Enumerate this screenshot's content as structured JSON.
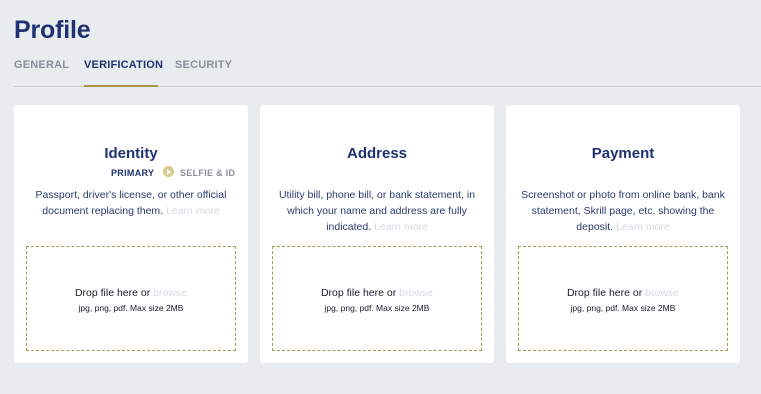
{
  "page": {
    "title": "Profile"
  },
  "tabs": [
    {
      "label": "GENERAL",
      "active": false
    },
    {
      "label": "VERIFICATION",
      "active": true
    },
    {
      "label": "SECURITY",
      "active": false
    }
  ],
  "cards": [
    {
      "title": "Identity",
      "steps": {
        "primary": "PRIMARY",
        "secondary": "SELFIE & ID"
      },
      "description": "Passport, driver's license, or other official document replacing them.",
      "learn_more": "Learn more",
      "drop_text": "Drop file here or",
      "browse": "browse",
      "hint": "jpg, png, pdf. Max size 2MB"
    },
    {
      "title": "Address",
      "description": "Utility bill, phone bill, or bank statement, in which your name and address are fully indicated.",
      "learn_more": "Learn more",
      "drop_text": "Drop file here or",
      "browse": "browse",
      "hint": "jpg, png, pdf. Max size 2MB"
    },
    {
      "title": "Payment",
      "description": "Screenshot or photo from online bank, bank statement, Skrill page, etc. showing the deposit.",
      "learn_more": "Learn more",
      "drop_text": "Drop file here or",
      "browse": "browse",
      "hint": "jpg, png, pdf. Max size 2MB"
    }
  ],
  "colors": {
    "primary": "#1f3170",
    "accent": "#a8974a",
    "muted": "#8a9099",
    "background": "#e9ecef"
  },
  "icons": {
    "step_arrow": "chevron-right-circle-icon"
  }
}
